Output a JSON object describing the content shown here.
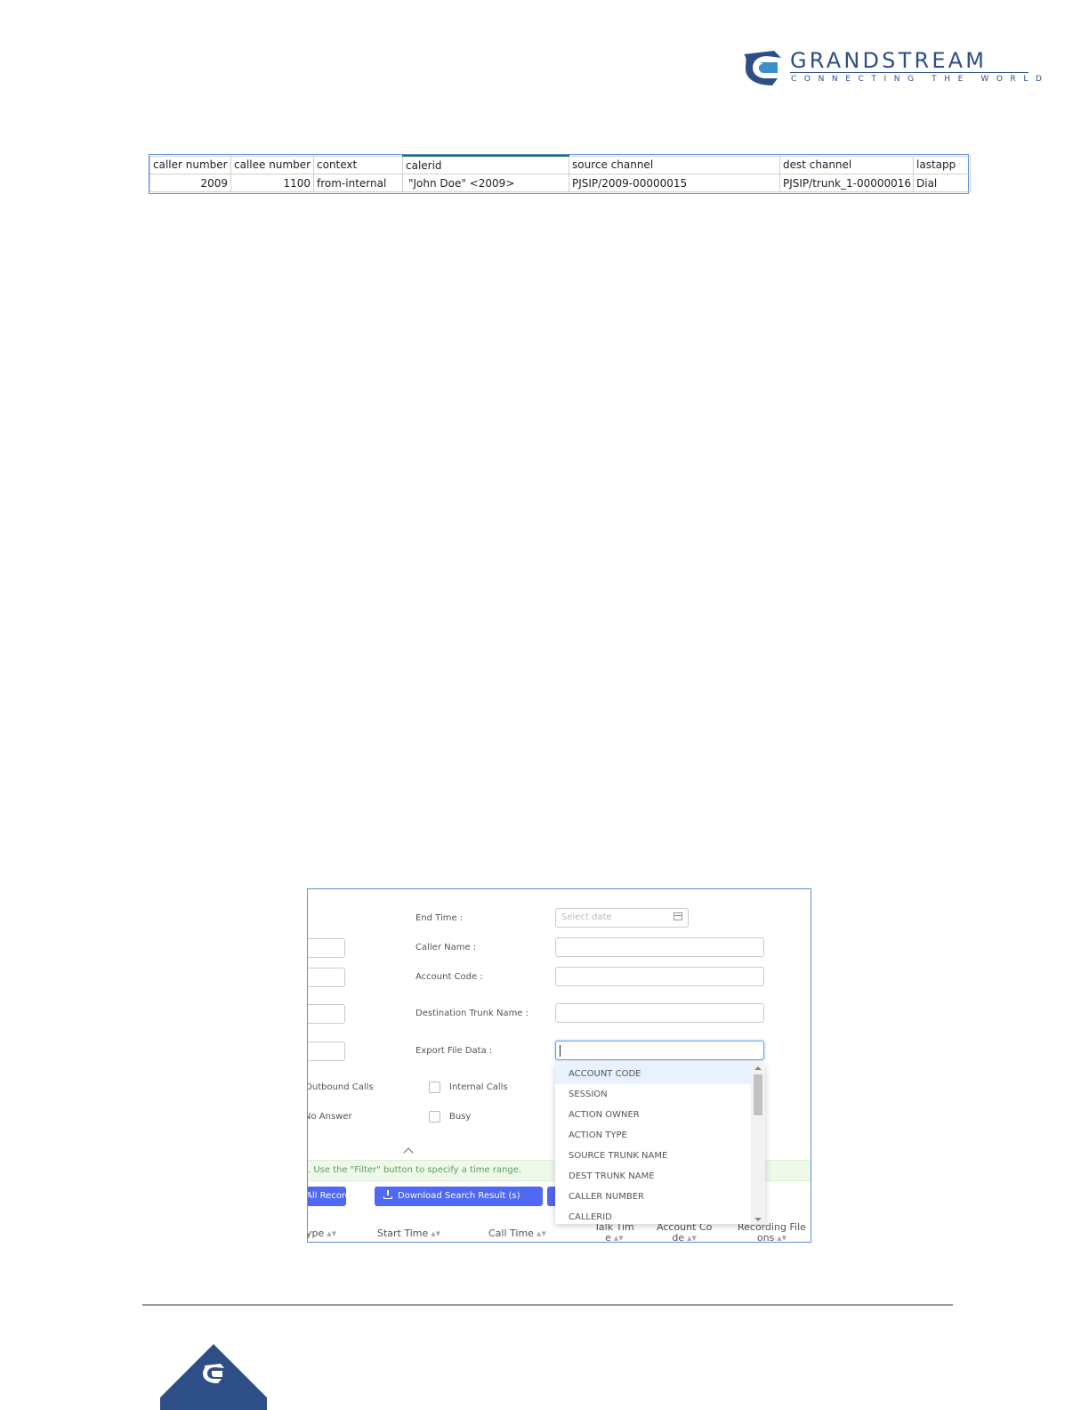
{
  "logo": {
    "word": "GRANDSTREAM",
    "tagline": "CONNECTING THE WORLD"
  },
  "spreadsheet": {
    "headers": [
      "caller number",
      "callee number",
      "context",
      "calerid",
      "source channel",
      "dest channel",
      "lastapp"
    ],
    "row": [
      "2009",
      "1100",
      "from-internal",
      "\"John Doe\" <2009>",
      "PJSIP/2009-00000015",
      "PJSIP/trunk_1-00000016",
      "Dial"
    ]
  },
  "filter": {
    "end_time_label": "End Time :",
    "date_placeholder": "Select date",
    "caller_name_label": "Caller Name :",
    "account_code_label": "Account Code :",
    "dest_trunk_label": "Destination Trunk Name :",
    "export_label": "Export File Data :",
    "checkboxes": [
      {
        "label": "Outbound Calls"
      },
      {
        "label": "Internal Calls"
      },
      {
        "label": "No Answer"
      },
      {
        "label": "Busy"
      }
    ],
    "dropdown_options": [
      "ACCOUNT CODE",
      "SESSION",
      "ACTION OWNER",
      "ACTION TYPE",
      "SOURCE TRUNK NAME",
      "DEST TRUNK NAME",
      "CALLER NUMBER",
      "CALLERID"
    ]
  },
  "notice": ". Use the \"Filter\" button to specify a time range.",
  "buttons": {
    "all_records": "All Records",
    "download": "Download Search Result (s)"
  },
  "columns": [
    {
      "label": "ype"
    },
    {
      "label": "Start Time"
    },
    {
      "label": "Call Time"
    },
    {
      "line1": "Talk Tim",
      "line2": "e"
    },
    {
      "line1": "Account Co",
      "line2": "de"
    },
    {
      "line1": "Recording File",
      "line2": "ons"
    }
  ],
  "colors": {
    "brand": "#2e4f86",
    "primary_button": "#5068f2",
    "notice_text": "#5aa25a"
  }
}
